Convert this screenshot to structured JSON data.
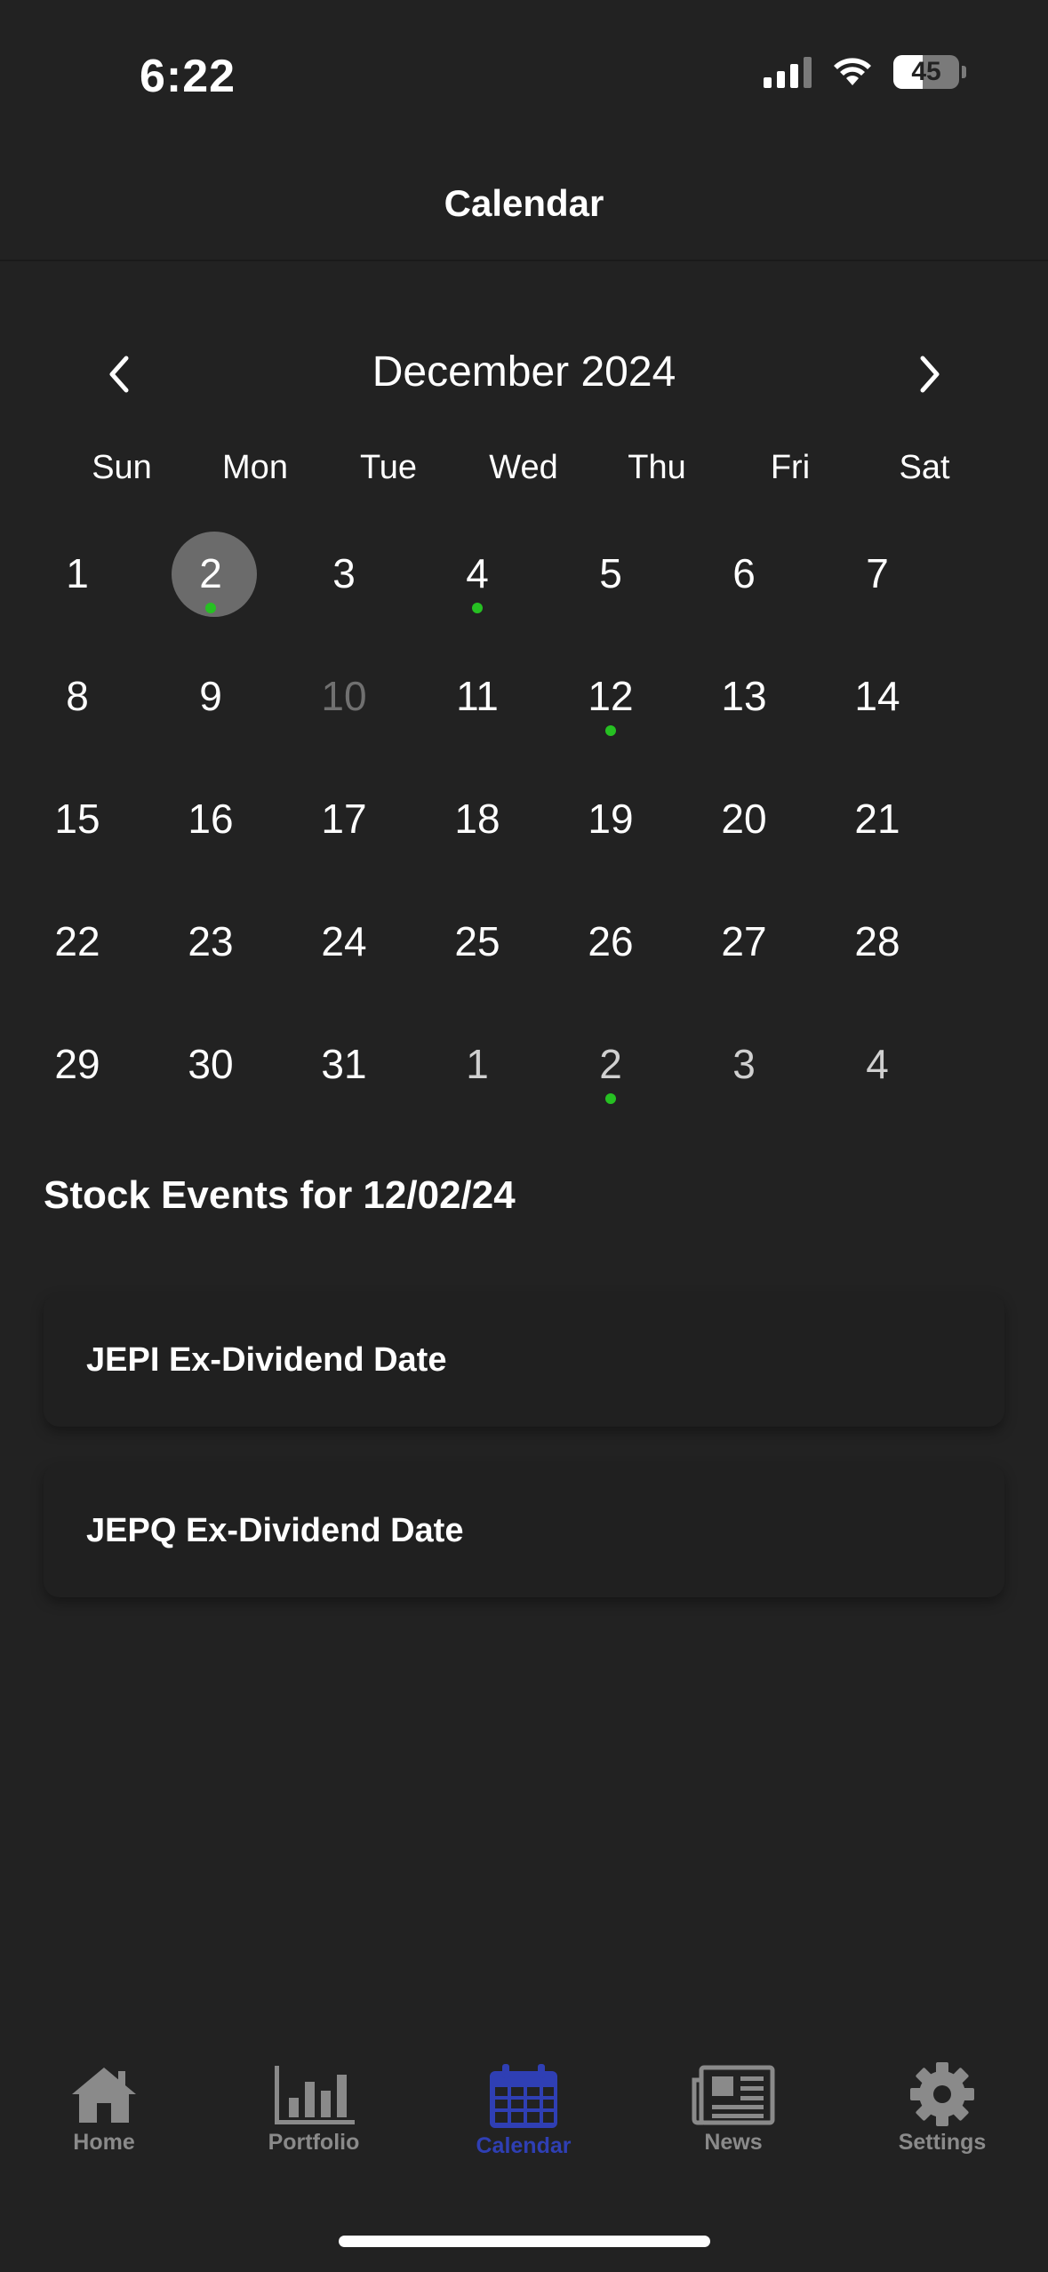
{
  "status_bar": {
    "time": "6:22",
    "battery": "45",
    "battery_level": 0.45
  },
  "header": {
    "title": "Calendar"
  },
  "calendar": {
    "month_label": "December 2024",
    "weekdays": [
      "Sun",
      "Mon",
      "Tue",
      "Wed",
      "Thu",
      "Fri",
      "Sat"
    ],
    "weeks": [
      [
        {
          "d": "1"
        },
        {
          "d": "2",
          "selected": true,
          "event": true
        },
        {
          "d": "3"
        },
        {
          "d": "4",
          "event": true
        },
        {
          "d": "5"
        },
        {
          "d": "6"
        },
        {
          "d": "7"
        }
      ],
      [
        {
          "d": "8"
        },
        {
          "d": "9"
        },
        {
          "d": "10",
          "muted": true
        },
        {
          "d": "11"
        },
        {
          "d": "12",
          "event": true
        },
        {
          "d": "13"
        },
        {
          "d": "14"
        }
      ],
      [
        {
          "d": "15"
        },
        {
          "d": "16"
        },
        {
          "d": "17"
        },
        {
          "d": "18"
        },
        {
          "d": "19"
        },
        {
          "d": "20"
        },
        {
          "d": "21"
        }
      ],
      [
        {
          "d": "22"
        },
        {
          "d": "23"
        },
        {
          "d": "24"
        },
        {
          "d": "25"
        },
        {
          "d": "26"
        },
        {
          "d": "27"
        },
        {
          "d": "28"
        }
      ],
      [
        {
          "d": "29"
        },
        {
          "d": "30"
        },
        {
          "d": "31"
        },
        {
          "d": "1",
          "other": true
        },
        {
          "d": "2",
          "other": true,
          "event": true
        },
        {
          "d": "3",
          "other": true
        },
        {
          "d": "4",
          "other": true
        }
      ]
    ],
    "event_dot_color": "#26c022",
    "selected_color": "#6b6b6b"
  },
  "events": {
    "heading": "Stock Events for 12/02/24",
    "items": [
      {
        "label": "JEPI Ex-Dividend Date"
      },
      {
        "label": "JEPQ Ex-Dividend Date"
      }
    ]
  },
  "tabbar": {
    "active_color": "#2f3fb4",
    "inactive_color": "#8a8a8a",
    "tabs": [
      {
        "label": "Home",
        "icon": "home-icon"
      },
      {
        "label": "Portfolio",
        "icon": "bar-chart-icon"
      },
      {
        "label": "Calendar",
        "icon": "calendar-icon",
        "active": true
      },
      {
        "label": "News",
        "icon": "newspaper-icon"
      },
      {
        "label": "Settings",
        "icon": "gear-icon"
      }
    ]
  }
}
